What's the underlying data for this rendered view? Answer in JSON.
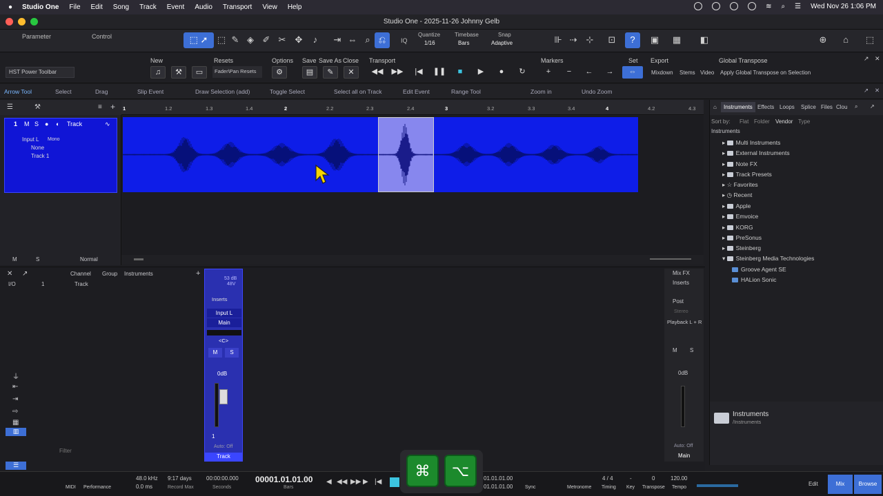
{
  "menubar": {
    "app": "Studio One",
    "items": [
      "File",
      "Edit",
      "Song",
      "Track",
      "Event",
      "Audio",
      "Transport",
      "View",
      "Help"
    ],
    "clock": "Wed Nov 26  1:06 PM"
  },
  "window": {
    "title": "Studio One - 2025-11-26 Johnny Gelb"
  },
  "toolbar": {
    "parameter": "Parameter",
    "control": "Control",
    "quantize_label": "Quantize",
    "quantize_value": "1/16",
    "timebase_label": "Timebase",
    "timebase_value": "Bars",
    "snap_label": "Snap",
    "snap_value": "Adaptive",
    "iq": "IQ"
  },
  "macros": {
    "preset": "HST Power Toolbar",
    "new": "New",
    "resets": "Resets",
    "resets_value": "Fader\\Pan Resets",
    "options": "Options",
    "save": "Save",
    "save_as": "Save As",
    "close": "Close",
    "transport": "Transport",
    "markers": "Markers",
    "set": "Set",
    "export": "Export",
    "mixdown": "Mixdown",
    "stems": "Stems",
    "video": "Video",
    "global_transpose": "Global Transpose",
    "apply_transpose": "Apply Global Transpose on Selection"
  },
  "tools": [
    "Arrow Tool",
    "Select",
    "Drag",
    "Slip Event",
    "Draw Selection (add)",
    "Toggle Select",
    "Select all on Track",
    "Edit Event",
    "Range Tool",
    "Zoom in",
    "Undo Zoom"
  ],
  "track": {
    "number": "1",
    "m": "M",
    "s": "S",
    "name": "Track",
    "input": "Input L",
    "mono": "Mono",
    "none": "None",
    "out": "Track 1",
    "normal": "Normal"
  },
  "ruler": [
    "1",
    "1.2",
    "1.3",
    "1.4",
    "2",
    "2.2",
    "2.3",
    "2.4",
    "3",
    "3.2",
    "3.3",
    "3.4",
    "4",
    "4.2",
    "4.3"
  ],
  "browser": {
    "tabs": [
      "Instruments",
      "Effects",
      "Loops",
      "Splice",
      "Files",
      "Clou"
    ],
    "sortby": "Sort by:",
    "sort_opts": [
      "Flat",
      "Folder",
      "Vendor",
      "Type"
    ],
    "crumb": "Instruments",
    "items": [
      "Multi Instruments",
      "External Instruments",
      "Note FX",
      "Track Presets",
      "Favorites",
      "Recent",
      "Apple",
      "Emvoice",
      "KORG",
      "PreSonus",
      "Steinberg",
      "Steinberg Media Technologies",
      "Groove Agent SE",
      "HALion Sonic"
    ],
    "footer_title": "Instruments",
    "footer_path": "/Instruments"
  },
  "console": {
    "channel": "Channel",
    "group": "Group",
    "instruments": "Instruments",
    "io": "I/O",
    "track_item": "Track",
    "filter": "Filter",
    "ch": {
      "gain": "53 dB",
      "v48": "48V",
      "inserts": "Inserts",
      "input": "Input L",
      "main": "Main",
      "pan": "<C>",
      "db": "0dB",
      "auto": "Auto: Off",
      "name": "Track",
      "num": "1"
    },
    "main": {
      "mixfx": "Mix FX",
      "inserts": "Inserts",
      "post": "Post",
      "stereo": "Stereo",
      "playback": "Playback L + R",
      "db": "0dB",
      "auto": "Auto: Off",
      "name": "Main"
    }
  },
  "transport": {
    "sr": "48.0 kHz",
    "latency": "0.0 ms",
    "rec": "9:17 days",
    "recmax": "Record Max",
    "time": "00:00:00.000",
    "seconds": "Seconds",
    "bars": "00001.01.01.00",
    "bars_label": "Bars",
    "loop1": "01.01.01.00",
    "loop2": "01.01.01.00",
    "sync": "Sync",
    "metronome": "Metronome",
    "timing": "4 / 4",
    "timing_label": "Timing",
    "key": "-",
    "key_label": "Key",
    "transpose": "0",
    "transpose_label": "Transpose",
    "tempo": "120.00",
    "tempo_label": "Tempo",
    "midi": "MIDI",
    "performance": "Performance",
    "edit": "Edit",
    "mix": "Mix",
    "browse": "Browse"
  },
  "keys": {
    "cmd": "⌘",
    "opt": "⌥"
  }
}
